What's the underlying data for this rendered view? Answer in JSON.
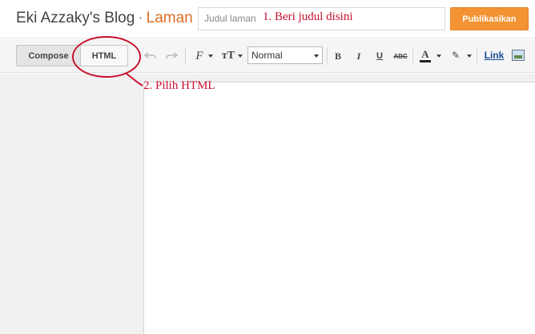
{
  "header": {
    "blog_name": "Eki Azzaky's Blog",
    "separator": "·",
    "section": "Laman",
    "title_placeholder": "Judul laman",
    "publish_label": "Publikasikan"
  },
  "toolbar": {
    "compose_label": "Compose",
    "html_label": "HTML",
    "undo_icon": "undo-icon",
    "redo_icon": "redo-icon",
    "font_glyph": "F",
    "size_glyph": "тT",
    "paragraph_style": "Normal",
    "bold_glyph": "B",
    "italic_glyph": "I",
    "underline_glyph": "U",
    "strike_glyph": "ABC",
    "text_color_glyph": "A",
    "highlight_glyph": "✎",
    "link_label": "Link"
  },
  "annotations": {
    "step1": "1. Beri judul disini",
    "step2": "2. Pilih HTML",
    "color": "#c8102e"
  },
  "colors": {
    "accent": "#f39332",
    "section_title": "#dd6e22",
    "link": "#1a4d9a"
  }
}
